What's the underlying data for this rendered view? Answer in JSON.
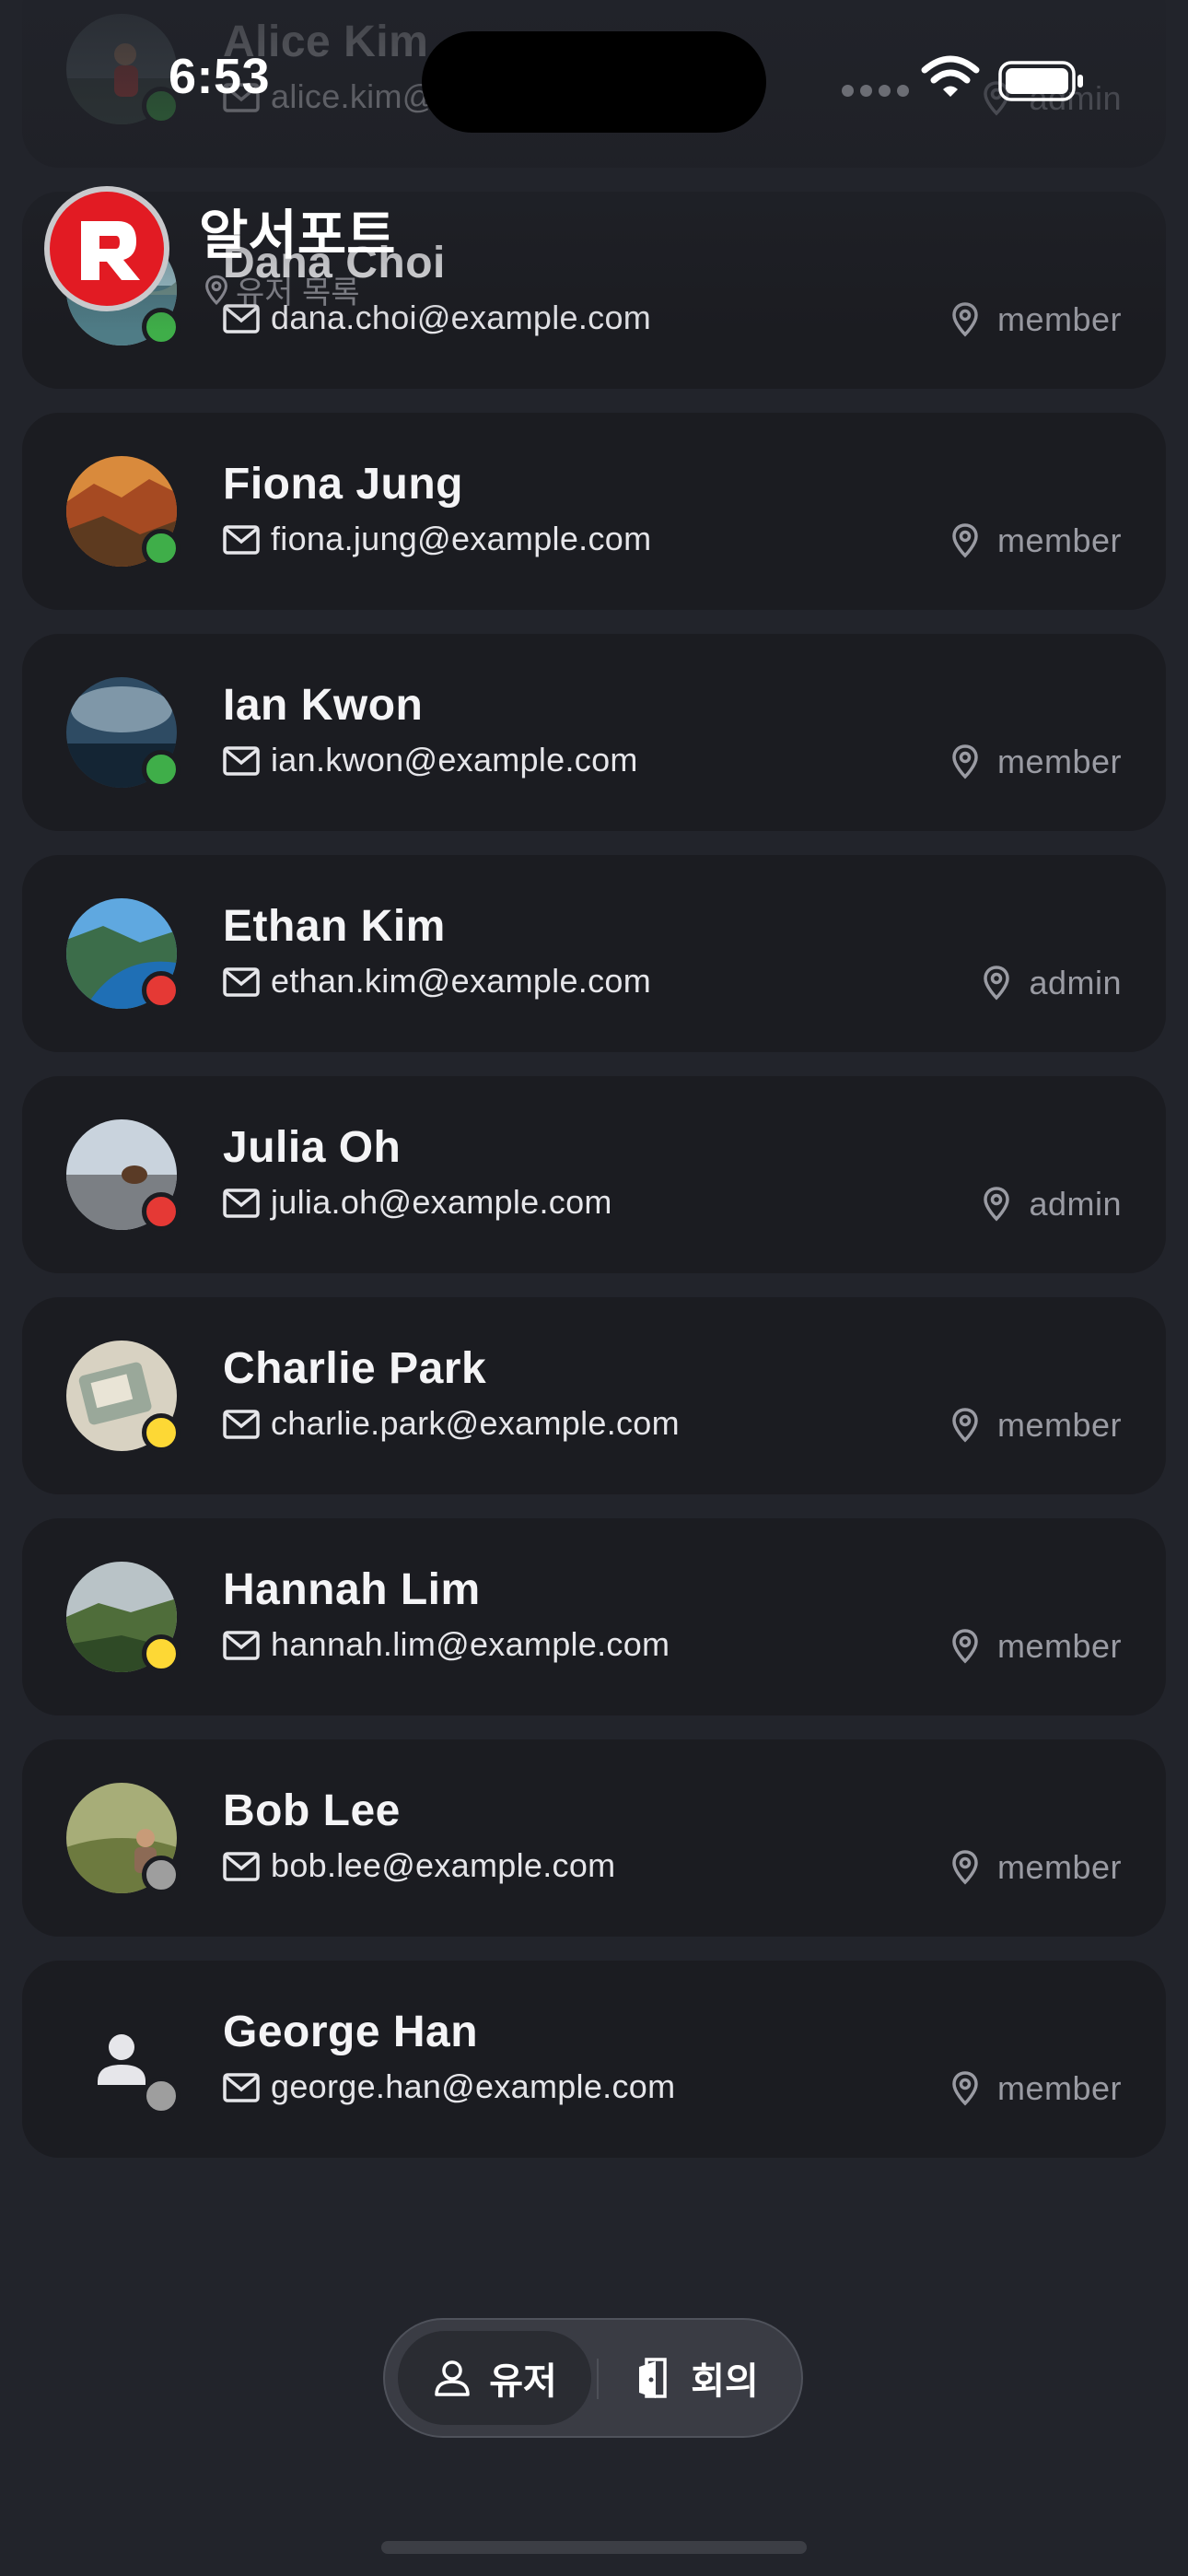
{
  "status_bar": {
    "time": "6:53"
  },
  "app": {
    "title": "알서포트",
    "subtitle": "유저 목록"
  },
  "users": [
    {
      "name": "Alice Kim",
      "email": "alice.kim@example.com",
      "role": "admin",
      "status": "online",
      "status_color": "#3fae49",
      "avatar": "person-hiking"
    },
    {
      "name": "Dana Choi",
      "email": "dana.choi@example.com",
      "role": "member",
      "status": "online",
      "status_color": "#3fae49",
      "avatar": "lake"
    },
    {
      "name": "Fiona Jung",
      "email": "fiona.jung@example.com",
      "role": "member",
      "status": "online",
      "status_color": "#3fae49",
      "avatar": "canyon"
    },
    {
      "name": "Ian Kwon",
      "email": "ian.kwon@example.com",
      "role": "member",
      "status": "online",
      "status_color": "#3fae49",
      "avatar": "storm-sea"
    },
    {
      "name": "Ethan Kim",
      "email": "ethan.kim@example.com",
      "role": "admin",
      "status": "busy",
      "status_color": "#e53935",
      "avatar": "fjord"
    },
    {
      "name": "Julia Oh",
      "email": "julia.oh@example.com",
      "role": "admin",
      "status": "busy",
      "status_color": "#e53935",
      "avatar": "beach-animal"
    },
    {
      "name": "Charlie Park",
      "email": "charlie.park@example.com",
      "role": "member",
      "status": "away",
      "status_color": "#fdd835",
      "avatar": "jeep"
    },
    {
      "name": "Hannah Lim",
      "email": "hannah.lim@example.com",
      "role": "member",
      "status": "away",
      "status_color": "#fdd835",
      "avatar": "green-cliffs"
    },
    {
      "name": "Bob Lee",
      "email": "bob.lee@example.com",
      "role": "member",
      "status": "offline",
      "status_color": "#9e9e9e",
      "avatar": "field-person"
    },
    {
      "name": "George Han",
      "email": "george.han@example.com",
      "role": "member",
      "status": "offline",
      "status_color": "#9e9e9e",
      "avatar": "default-person-icon"
    }
  ],
  "tabs": [
    {
      "label": "유저",
      "icon": "person-icon",
      "selected": true
    },
    {
      "label": "회의",
      "icon": "door-icon",
      "selected": false
    }
  ],
  "colors": {
    "background": "#22242b",
    "card": "#1b1c21",
    "brand_red": "#e21b23"
  }
}
